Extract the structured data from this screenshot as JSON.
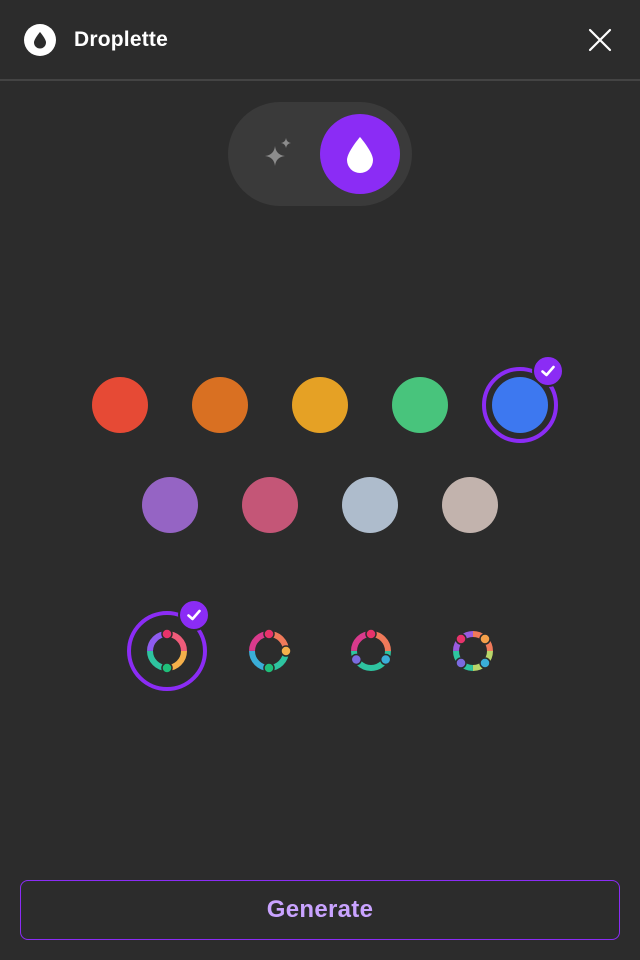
{
  "header": {
    "app_title": "Droplette",
    "logo_icon": "droplet-icon",
    "close_icon": "close-icon"
  },
  "mode_toggle": {
    "options": [
      {
        "icon": "sparkles-icon",
        "active": false
      },
      {
        "icon": "droplet-icon",
        "active": true
      }
    ],
    "accent": "#8b2cf5"
  },
  "colors": {
    "row1": [
      "#e64a35",
      "#d97022",
      "#e5a125",
      "#48c47c",
      "#3d78f0"
    ],
    "row2": [
      "#9564c4",
      "#c45677",
      "#aebccc",
      "#c2b3ad"
    ],
    "selected": "#3d78f0"
  },
  "styles": {
    "options": [
      "palette-style-1-icon",
      "palette-style-2-icon",
      "palette-style-3-icon",
      "palette-style-4-icon"
    ],
    "selected_index": 0
  },
  "actions": {
    "generate_label": "Generate"
  }
}
